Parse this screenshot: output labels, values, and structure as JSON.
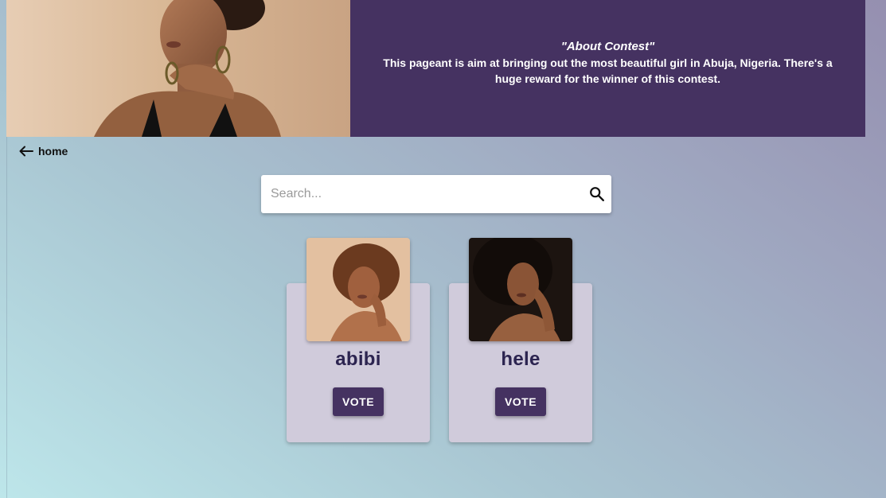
{
  "banner": {
    "about_title": "\"About Contest\"",
    "about_text": "This pageant is aim at bringing out the most beautiful girl in Abuja, Nigeria. There's a huge reward for the winner of this contest.",
    "panel_color": "#453261"
  },
  "nav": {
    "home_label": "home",
    "home_icon": "arrow-left-icon"
  },
  "search": {
    "placeholder": "Search...",
    "value": "",
    "icon": "search-icon"
  },
  "contestants": [
    {
      "name": "abibi",
      "vote_label": "VOTE"
    },
    {
      "name": "hele",
      "vote_label": "VOTE"
    }
  ],
  "colors": {
    "accent": "#453261",
    "card_bg": "#d0cbdb",
    "name_text": "#2c2450"
  }
}
